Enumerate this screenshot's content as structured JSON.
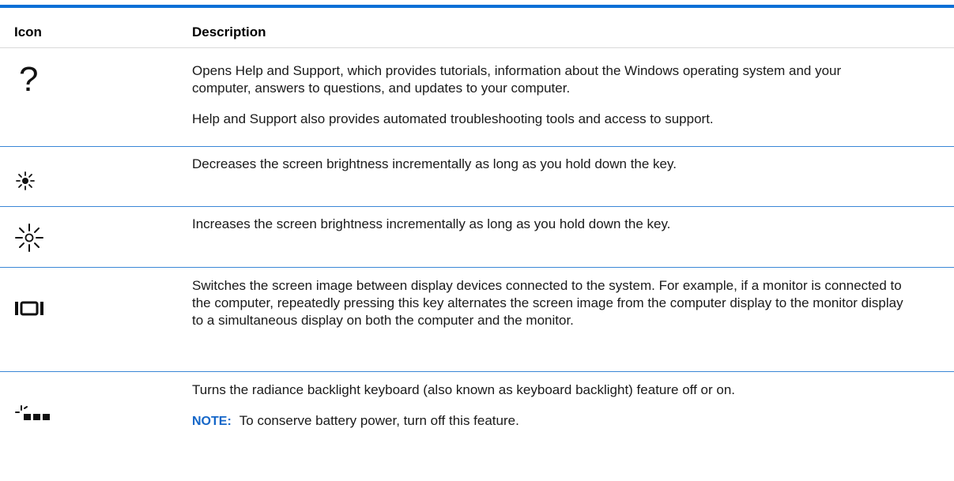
{
  "table": {
    "headers": {
      "icon": "Icon",
      "description": "Description"
    },
    "rows": [
      {
        "icon": "help-question-icon",
        "paragraphs": [
          "Opens Help and Support, which provides tutorials, information about the Windows operating system and your computer, answers to questions, and updates to your computer.",
          "Help and Support also provides automated troubleshooting tools and access to support."
        ]
      },
      {
        "icon": "brightness-down-icon",
        "paragraphs": [
          "Decreases the screen brightness incrementally as long as you hold down the key."
        ]
      },
      {
        "icon": "brightness-up-icon",
        "paragraphs": [
          "Increases the screen brightness incrementally as long as you hold down the key."
        ]
      },
      {
        "icon": "switch-display-icon",
        "paragraphs": [
          "Switches the screen image between display devices connected to the system. For example, if a monitor is connected to the computer, repeatedly pressing this key alternates the screen image from the computer display to the monitor display to a simultaneous display on both the computer and the monitor."
        ]
      },
      {
        "icon": "keyboard-backlight-icon",
        "paragraphs": [
          "Turns the radiance backlight keyboard (also known as keyboard backlight) feature off or on."
        ],
        "note": {
          "label": "NOTE:",
          "text": "To conserve battery power, turn off this feature."
        }
      }
    ]
  },
  "colors": {
    "accent_rule": "#0a6fd6",
    "row_divider": "#3a87d6",
    "note_label": "#1466c8"
  }
}
